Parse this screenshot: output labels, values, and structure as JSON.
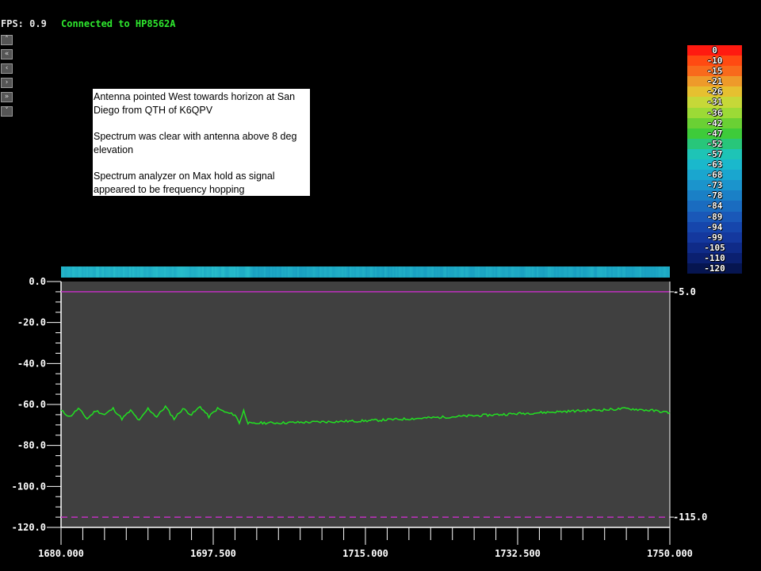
{
  "header": {
    "fps": "FPS: 0.9",
    "connection": "Connected to HP8562A"
  },
  "nav": [
    {
      "name": "up-icon",
      "glyph": "˄"
    },
    {
      "name": "double-left-icon",
      "glyph": "«"
    },
    {
      "name": "left-icon",
      "glyph": "‹"
    },
    {
      "name": "right-icon",
      "glyph": "›"
    },
    {
      "name": "double-right-icon",
      "glyph": "»"
    },
    {
      "name": "down-icon",
      "glyph": "˅"
    }
  ],
  "note": {
    "paragraphs": [
      "Antenna pointed West towards horizon at San Diego from QTH of K6QPV",
      "Spectrum was clear with antenna above 8 deg elevation",
      "Spectrum analyzer on Max hold as signal appeared to be frequency hopping"
    ]
  },
  "colorscale": [
    {
      "label": "0",
      "color": "#ff1a10"
    },
    {
      "label": "-10",
      "color": "#ff4a12"
    },
    {
      "label": "-15",
      "color": "#f86a1c"
    },
    {
      "label": "-21",
      "color": "#ee9a2a"
    },
    {
      "label": "-26",
      "color": "#e6c030"
    },
    {
      "label": "-31",
      "color": "#c6d838"
    },
    {
      "label": "-36",
      "color": "#9cda36"
    },
    {
      "label": "-42",
      "color": "#6ad034"
    },
    {
      "label": "-47",
      "color": "#3ecb3a"
    },
    {
      "label": "-52",
      "color": "#28c67a"
    },
    {
      "label": "-57",
      "color": "#1ec4b6"
    },
    {
      "label": "-63",
      "color": "#1ab8cc"
    },
    {
      "label": "-68",
      "color": "#1aa6cf"
    },
    {
      "label": "-73",
      "color": "#1b94cc"
    },
    {
      "label": "-78",
      "color": "#1a80c6"
    },
    {
      "label": "-84",
      "color": "#1a6cc0"
    },
    {
      "label": "-89",
      "color": "#1a58b8"
    },
    {
      "label": "-94",
      "color": "#1646ac"
    },
    {
      "label": "-99",
      "color": "#14389e"
    },
    {
      "label": "-105",
      "color": "#0f2b88"
    },
    {
      "label": "-110",
      "color": "#0b2070"
    },
    {
      "label": "-120",
      "color": "#061550"
    }
  ],
  "chart_data": {
    "type": "line",
    "x_ticks": [
      "1680.000",
      "1697.500",
      "1715.000",
      "1732.500",
      "1750.000"
    ],
    "y_ticks": [
      "0.0",
      "-20.0",
      "-40.0",
      "-60.0",
      "-80.0",
      "-100.0",
      "-120.0"
    ],
    "xlim": [
      1680,
      1750
    ],
    "ylim": [
      -120,
      0
    ],
    "grid": false,
    "markers": [
      {
        "label": "-5.0",
        "value": -5.0,
        "style": "solid",
        "color": "#c030c0"
      },
      {
        "label": "-115.0",
        "value": -115.0,
        "style": "dashed",
        "color": "#c030c0"
      }
    ],
    "series": [
      {
        "color": "#22e022",
        "x": [
          1680,
          1681,
          1682,
          1683,
          1684,
          1685,
          1686,
          1687,
          1688,
          1689,
          1690,
          1691,
          1692,
          1693,
          1694,
          1695,
          1696,
          1697,
          1698,
          1699,
          1700,
          1700.5,
          1701,
          1701.5,
          1702,
          1703,
          1705,
          1710,
          1715,
          1720,
          1725,
          1730,
          1735,
          1740,
          1743,
          1745,
          1748,
          1750
        ],
        "y": [
          -63,
          -66,
          -62,
          -67,
          -63,
          -65,
          -62,
          -67,
          -63,
          -68,
          -62,
          -66,
          -61,
          -67,
          -62,
          -65,
          -61,
          -66,
          -62,
          -64,
          -65,
          -69,
          -63,
          -69,
          -69.5,
          -69,
          -69,
          -68.5,
          -68,
          -67,
          -66,
          -65,
          -64,
          -63,
          -62.5,
          -62,
          -63,
          -64
        ]
      }
    ]
  }
}
